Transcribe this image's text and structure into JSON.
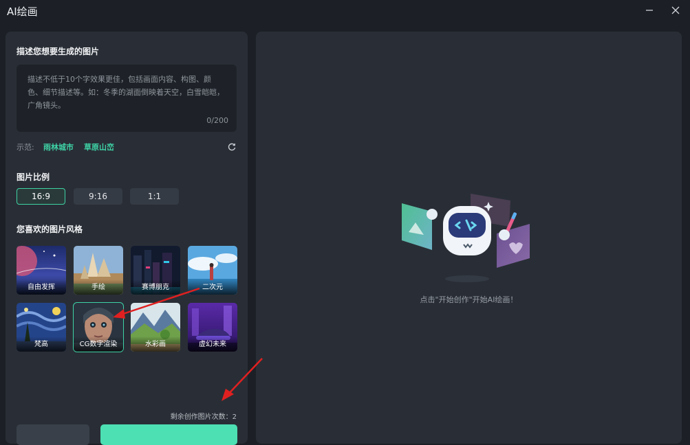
{
  "window": {
    "title": "AI绘画"
  },
  "prompt": {
    "section_title": "描述您想要生成的图片",
    "placeholder": "描述不低于10个字效果更佳，包括画面内容、构图、颜色、细节描述等。如：冬季的湖面倒映着天空，白雪皑皑，广角镜头。",
    "value": "",
    "char_count": "0/200"
  },
  "examples": {
    "label": "示范:",
    "items": [
      "雨林城市",
      "草原山峦"
    ]
  },
  "ratio": {
    "section_title": "图片比例",
    "options": [
      "16:9",
      "9:16",
      "1:1"
    ],
    "selected": "16:9"
  },
  "styles": {
    "section_title": "您喜欢的图片风格",
    "items": [
      "自由发挥",
      "手绘",
      "赛博朋克",
      "二次元",
      "梵高",
      "CG数字渲染",
      "水彩画",
      "虚幻未来"
    ],
    "selected": "CG数字渲染"
  },
  "remaining_label": "剩余创作图片次数：2",
  "empty_state": {
    "hint": "点击\"开始创作\"开始AI绘画！"
  },
  "colors": {
    "accent": "#3ed3a6",
    "panel": "#292e36",
    "background": "#1c2026"
  }
}
